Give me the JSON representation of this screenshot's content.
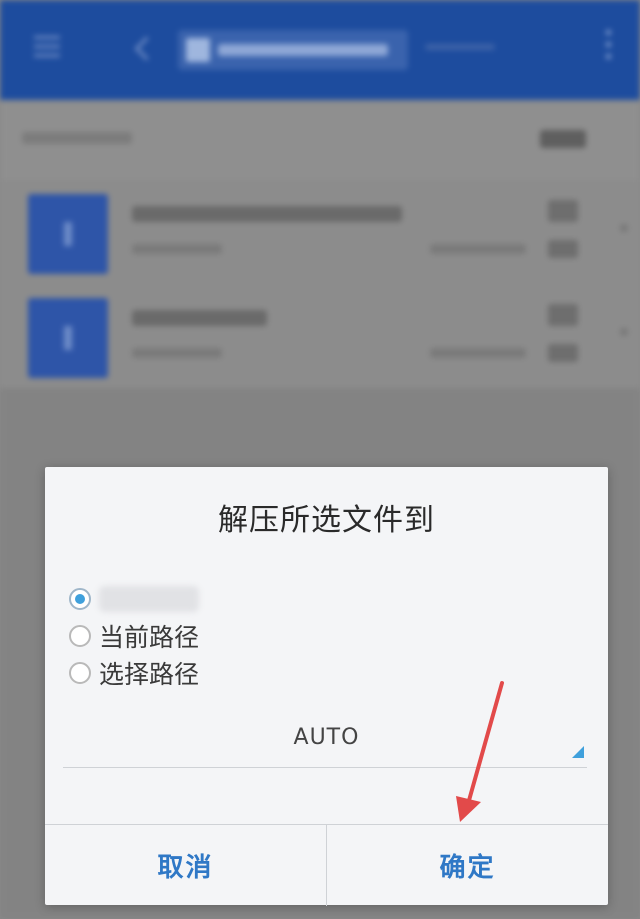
{
  "dialog": {
    "title": "解压所选文件到",
    "options": [
      {
        "label": "",
        "selected": true
      },
      {
        "label": "当前路径",
        "selected": false
      },
      {
        "label": "选择路径",
        "selected": false
      }
    ],
    "encoding_value": "AUTO",
    "cancel_label": "取消",
    "ok_label": "确定"
  },
  "colors": {
    "accent": "#3fa0dc",
    "button_text": "#2f78c6",
    "app_bar": "#1d4c9e",
    "annotation_arrow": "#e24a4a"
  }
}
